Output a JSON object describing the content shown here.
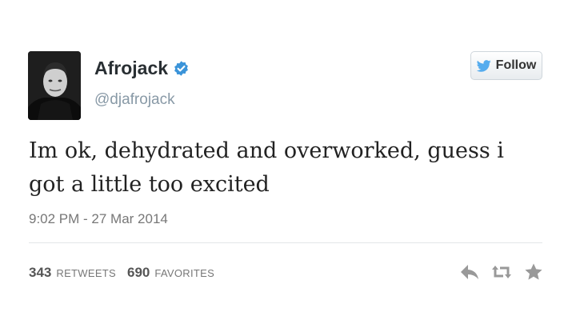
{
  "user": {
    "display_name": "Afrojack",
    "handle": "@djafrojack",
    "avatar_icon": "profile-photo",
    "verified_icon": "verified-badge-icon"
  },
  "follow": {
    "label": "Follow",
    "icon": "twitter-bird-icon"
  },
  "tweet": {
    "text": "Im ok, dehydrated and overworked, guess i got a little too excited",
    "timestamp": "9:02 PM - 27 Mar 2014"
  },
  "stats": {
    "retweets_count": "343",
    "retweets_label": "RETWEETS",
    "favorites_count": "690",
    "favorites_label": "FAVORITES"
  },
  "actions": [
    "reply-icon",
    "retweet-icon",
    "favorite-icon"
  ],
  "colors": {
    "verified": "#3b94d9",
    "bird": "#55acee",
    "icons": "#999999"
  }
}
